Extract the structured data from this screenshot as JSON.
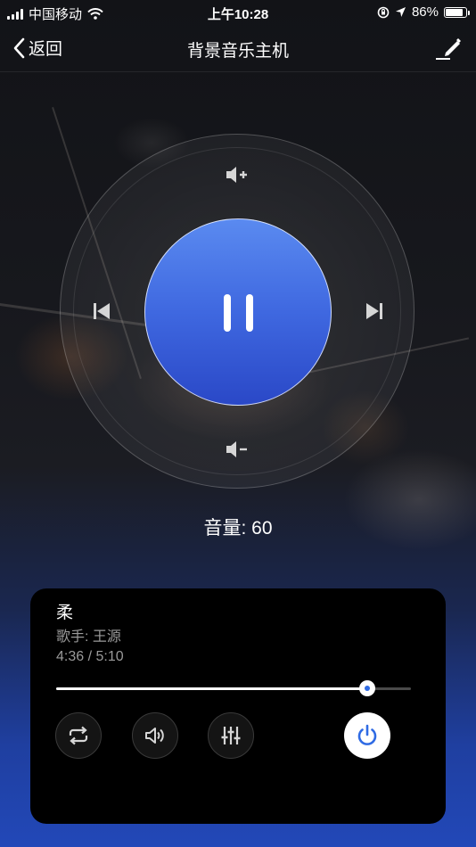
{
  "status_bar": {
    "carrier": "中国移动",
    "time": "上午10:28",
    "battery_text": "86%",
    "battery_level": 0.86,
    "icons": [
      "signal-icon",
      "wifi-icon",
      "orientation-lock-icon",
      "location-icon",
      "battery-icon"
    ]
  },
  "nav": {
    "back_label": "返回",
    "title": "背景音乐主机",
    "edit_icon": "edit-pencil-icon"
  },
  "controls": {
    "volume_up_icon": "volume-up-icon",
    "volume_down_icon": "volume-down-icon",
    "prev_icon": "skip-previous-icon",
    "next_icon": "skip-next-icon",
    "play_state_icon": "pause-icon"
  },
  "volume": {
    "label": "音量: 60",
    "value": 60
  },
  "player": {
    "song_title": "柔",
    "singer": "歌手: 王源",
    "time": "4:36 / 5:10",
    "progress": 0.876,
    "buttons": [
      "repeat-icon",
      "sound-icon",
      "equalizer-icon",
      "power-icon"
    ],
    "accent_color": "#2f6be4"
  }
}
